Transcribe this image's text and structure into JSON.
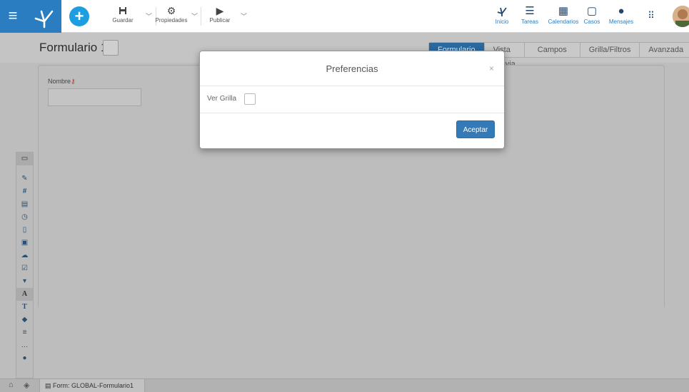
{
  "toolbar": {
    "menu_icon": "hamburger-icon",
    "logo_icon": "deyel-logo-icon",
    "new_icon": "plus-icon",
    "save_label": "Guardar",
    "properties_label": "Propiedades",
    "publish_label": "Publicar"
  },
  "nav": {
    "inicio": "Inicio",
    "tareas": "Tareas",
    "calendarios": "Calendarios",
    "casos": "Casos",
    "mensajes": "Mensajes"
  },
  "form": {
    "title": "Formulario 1",
    "tabs": [
      "Formulario",
      "Vista Previa",
      "Campos",
      "Grilla/Filtros",
      "Avanzada"
    ],
    "field_label": "Nombre"
  },
  "palette": {
    "items": [
      "monitor-icon",
      "edit-icon",
      "hash-icon",
      "calendar-icon",
      "clock-icon",
      "file-icon",
      "image-icon",
      "cloud-icon",
      "checkbox-icon",
      "dropdown-icon",
      "text-A-icon",
      "text-T-icon",
      "tag-icon",
      "align-icon",
      "ellipsis-icon",
      "circle-icon"
    ]
  },
  "bottom": {
    "tab_label": "Form: GLOBAL-Formulario1"
  },
  "modal": {
    "title": "Preferencias",
    "close": "×",
    "ver_grilla_label": "Ver Grilla",
    "accept_label": "Aceptar"
  },
  "colors": {
    "primary": "#2a7dc0",
    "accept": "#337ab7",
    "tab_active": "#2a6a9f"
  }
}
